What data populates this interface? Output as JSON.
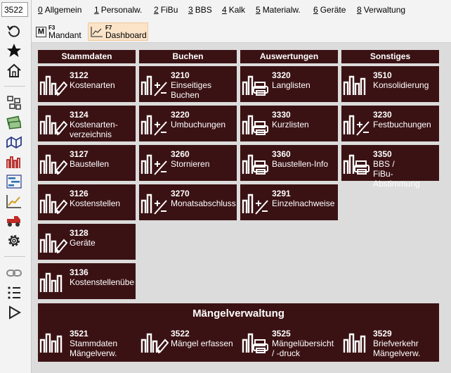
{
  "code_input": {
    "value": "3522"
  },
  "menu": [
    {
      "num": "0",
      "label": "Allgemein"
    },
    {
      "num": "1",
      "label": "Personalw."
    },
    {
      "num": "2",
      "label": "FiBu"
    },
    {
      "num": "3",
      "label": "BBS"
    },
    {
      "num": "4",
      "label": "Kalk"
    },
    {
      "num": "5",
      "label": "Materialw."
    },
    {
      "num": "6",
      "label": "Geräte"
    },
    {
      "num": "8",
      "label": "Verwaltung"
    }
  ],
  "toolbar": {
    "mandant": {
      "key": "F3",
      "label": "Mandant",
      "icon_letter": "M"
    },
    "dashboard": {
      "key": "F7",
      "label": "Dashboard"
    }
  },
  "sidebar_icons": [
    "refresh-icon",
    "star-icon",
    "home-icon",
    "network-icon",
    "money-icon",
    "map-icon",
    "bar-chart-icon",
    "gantt-icon",
    "line-chart-icon",
    "vehicle-icon",
    "gear-icon",
    "link-icon",
    "list-icon",
    "play-icon"
  ],
  "colors": {
    "tile_bg": "#3b1214",
    "accent": "#f0c89a",
    "icon_stroke": "#ffffff"
  },
  "columns": [
    {
      "header": "Stammdaten",
      "tiles": [
        {
          "code": "3122",
          "label": "Kostenarten",
          "icon": "chart-pencil-icon"
        },
        {
          "code": "3124",
          "label": "Kostenarten-\nverzeichnis",
          "icon": "chart-pencil-icon"
        },
        {
          "code": "3127",
          "label": "Baustellen",
          "icon": "chart-pencil-icon"
        },
        {
          "code": "3126",
          "label": "Kostenstellen",
          "icon": "chart-pencil-icon"
        },
        {
          "code": "3128",
          "label": "Geräte",
          "icon": "chart-pencil-icon"
        },
        {
          "code": "3136",
          "label": "Kostenstellenübersicht",
          "icon": "bar-chart-icon"
        }
      ]
    },
    {
      "header": "Buchen",
      "tiles": [
        {
          "code": "3210",
          "label": "Einseitiges\nBuchen",
          "icon": "chart-plusminus-icon"
        },
        {
          "code": "3220",
          "label": "Umbuchungen",
          "icon": "chart-plusminus-icon"
        },
        {
          "code": "3260",
          "label": "Stornieren",
          "icon": "chart-plusminus-icon"
        },
        {
          "code": "3270",
          "label": "Monatsabschluss",
          "icon": "chart-plusminus-icon"
        }
      ]
    },
    {
      "header": "Auswertungen",
      "tiles": [
        {
          "code": "3320",
          "label": "Langlisten",
          "icon": "chart-printer-icon"
        },
        {
          "code": "3330",
          "label": "Kurzlisten",
          "icon": "chart-printer-icon"
        },
        {
          "code": "3360",
          "label": "Baustellen-Info",
          "icon": "chart-printer-icon"
        },
        {
          "code": "3291",
          "label": "Einzelnachweise",
          "icon": "chart-plusminus-icon"
        }
      ]
    },
    {
      "header": "Sonstiges",
      "tiles": [
        {
          "code": "3510",
          "label": "Konsolidierung",
          "icon": "bar-chart-icon"
        },
        {
          "code": "3230",
          "label": "Festbuchungen",
          "icon": "chart-plusminus-icon"
        },
        {
          "code": "3350",
          "label": "BBS /\nFiBu-Abstimmung",
          "icon": "chart-printer-icon"
        }
      ]
    }
  ],
  "maengel": {
    "title": "Mängelverwaltung",
    "tiles": [
      {
        "code": "3521",
        "label": "Stammdaten\nMängelverw.",
        "icon": "bar-chart-icon"
      },
      {
        "code": "3522",
        "label": "Mängel erfassen",
        "icon": "chart-pencil-icon"
      },
      {
        "code": "3525",
        "label": "Mängelübersicht\n/ -druck",
        "icon": "chart-printer-icon"
      },
      {
        "code": "3529",
        "label": "Briefverkehr\nMängelverw.",
        "icon": "bar-chart-icon"
      }
    ]
  }
}
